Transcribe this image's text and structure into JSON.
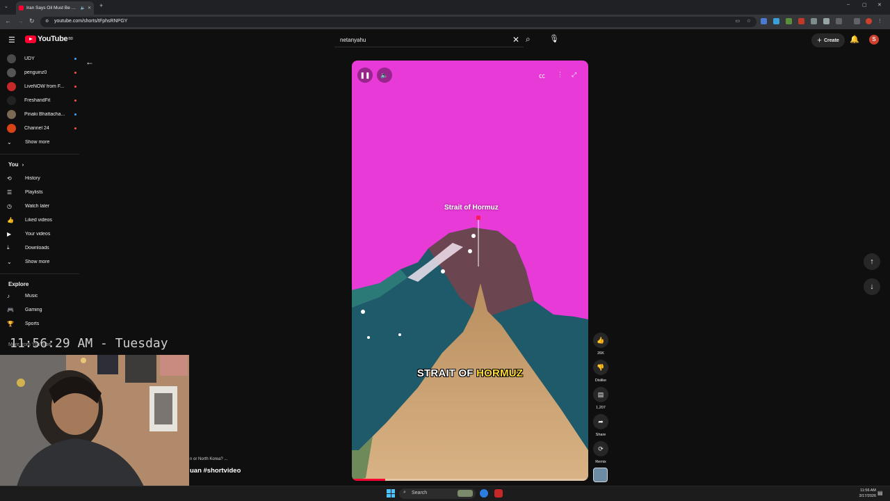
{
  "browser": {
    "tab_title": "Iran Says Oil Must Be Sold",
    "url": "youtube.com/shorts/tFphsRNPGY",
    "new_tab": "+"
  },
  "header": {
    "logo_text": "YouTube",
    "logo_region": "BD",
    "search_query": "netanyahu",
    "create_label": "Create",
    "avatar_letter": "S"
  },
  "sidebar": {
    "subscriptions": [
      {
        "label": "UDY",
        "avatar_color": "#4a4a4a",
        "dot_color": "#3ea6ff"
      },
      {
        "label": "penguinz0",
        "avatar_color": "#555555",
        "dot_color": "#ff4e45"
      },
      {
        "label": "LiveNOW from F...",
        "avatar_color": "#c62828",
        "dot_color": "#ff4e45"
      },
      {
        "label": "FreshandFit",
        "avatar_color": "#222222",
        "dot_color": "#ff4e45"
      },
      {
        "label": "Pinaki Bhattacha...",
        "avatar_color": "#7a6a55",
        "dot_color": "#3ea6ff"
      },
      {
        "label": "Channel 24",
        "avatar_color": "#d84315",
        "dot_color": "#ff4e45"
      }
    ],
    "show_more_1": "Show more",
    "you_heading": "You",
    "you_items": [
      {
        "label": "History",
        "icon": "history-icon",
        "glyph": "⟲"
      },
      {
        "label": "Playlists",
        "icon": "playlists-icon",
        "glyph": "☰"
      },
      {
        "label": "Watch later",
        "icon": "clock-icon",
        "glyph": "◷"
      },
      {
        "label": "Liked videos",
        "icon": "thumbs-up-icon",
        "glyph": "👍"
      },
      {
        "label": "Your videos",
        "icon": "video-icon",
        "glyph": "▶"
      },
      {
        "label": "Downloads",
        "icon": "download-icon",
        "glyph": "⤓"
      }
    ],
    "show_more_2": "Show more",
    "explore_heading": "Explore",
    "explore_items": [
      {
        "label": "Music",
        "icon": "music-icon",
        "glyph": "♪"
      },
      {
        "label": "Gaming",
        "icon": "gaming-icon",
        "glyph": "🎮"
      },
      {
        "label": "Sports",
        "icon": "trophy-icon",
        "glyph": "🏆"
      }
    ],
    "more_from": "More from YouTube"
  },
  "player": {
    "place_label": "Strait of Hormuz",
    "caption_white": "STRAIT OF ",
    "caption_yellow": "HORMUZ",
    "progress": 0.14,
    "colors": {
      "land_magenta": "#e83ad7",
      "water": "#1f5a6a",
      "sand": "#c99a66",
      "highlight": "#ffdd33"
    }
  },
  "actions": {
    "likes": "26K",
    "dislike": "Dislike",
    "comments": "1,207",
    "share": "Share",
    "remix": "Remix"
  },
  "overlay": {
    "clock": "11:56:29 AM - Tuesday",
    "meta_sub": "n or North Korea? ...",
    "meta_title": "uan #shortvideo"
  },
  "taskbar": {
    "search_placeholder": "Search",
    "time": "11:56 AM",
    "date": "3/17/2026"
  }
}
